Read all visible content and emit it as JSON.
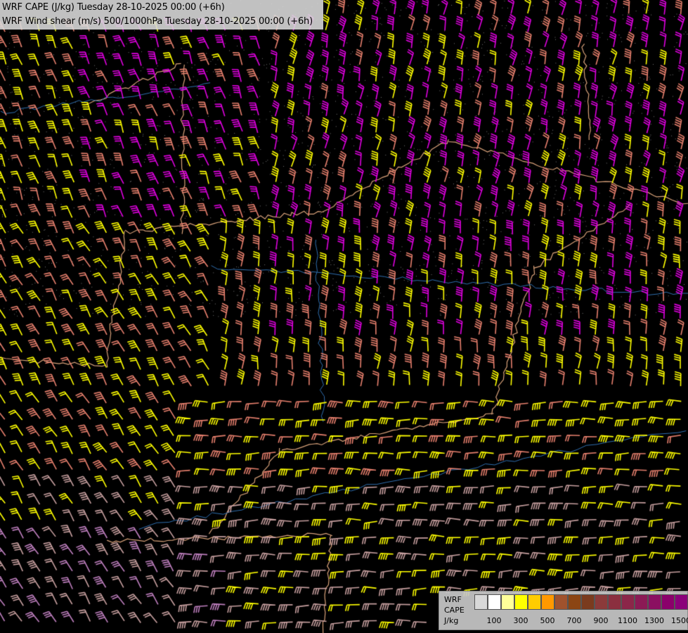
{
  "header": {
    "line1": "WRF CAPE (J/kg) Tuesday 28-10-2025 00:00 (+6h)",
    "line2": "WRF Wind shear (m/s) 500/1000hPa Tuesday 28-10-2025 00:00 (+6h)"
  },
  "legend": {
    "name_line1": "WRF",
    "name_line2": "CAPE",
    "unit": "J/kg",
    "colors": [
      "#d8d8d8",
      "#ffffff",
      "#ffff99",
      "#ffff00",
      "#ffcc00",
      "#ff9900",
      "#a0522d",
      "#8b4513",
      "#7a3b1e",
      "#8b3a3a",
      "#8b2f3f",
      "#8b2649",
      "#8b1a55",
      "#8b1061",
      "#8b006b",
      "#8b007a"
    ],
    "tick_labels": [
      "100",
      "300",
      "500",
      "700",
      "900",
      "1100",
      "1300",
      "1500"
    ]
  },
  "map": {
    "background": "#000000",
    "barb_colors": {
      "low_shear": "#c8a0a0",
      "moderate_shear": "#e8806e",
      "strong_shear": "#ffff00",
      "very_strong_shear": "#e000e0",
      "weak_shear": "#c080c0"
    }
  }
}
